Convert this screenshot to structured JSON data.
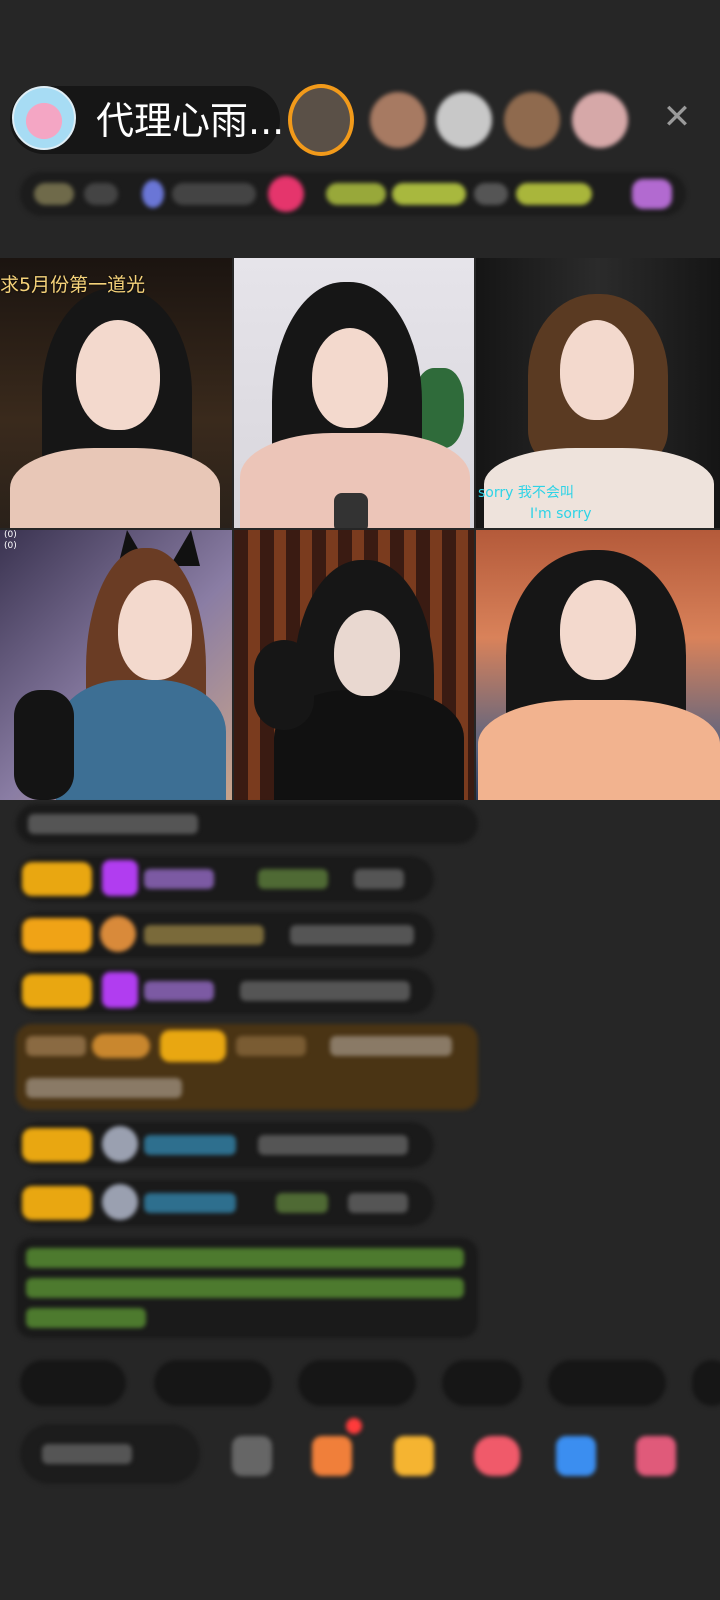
{
  "header": {
    "host_name": "代理心雨...",
    "close_icon": "close-icon"
  },
  "video_grid": {
    "overlay_title": "求5月份第一道光",
    "subtitle_line1": "sorry 我不会叫",
    "subtitle_line2": "I'm sorry",
    "tick_marks": "(0)\n(0)"
  },
  "colors": {
    "background": "#262626",
    "badge": "#e9a711",
    "vip_purple": "#b13df0",
    "chat_text_green": "#7dbb3e",
    "chat_name_blue": "#2ea3d6",
    "subtitle_cyan": "#2ed3e6"
  },
  "icons": [
    "close-icon",
    "gift-box-icon",
    "gift-bag-icon",
    "red-envelope-icon",
    "game-icon",
    "more-gifts-icon"
  ]
}
